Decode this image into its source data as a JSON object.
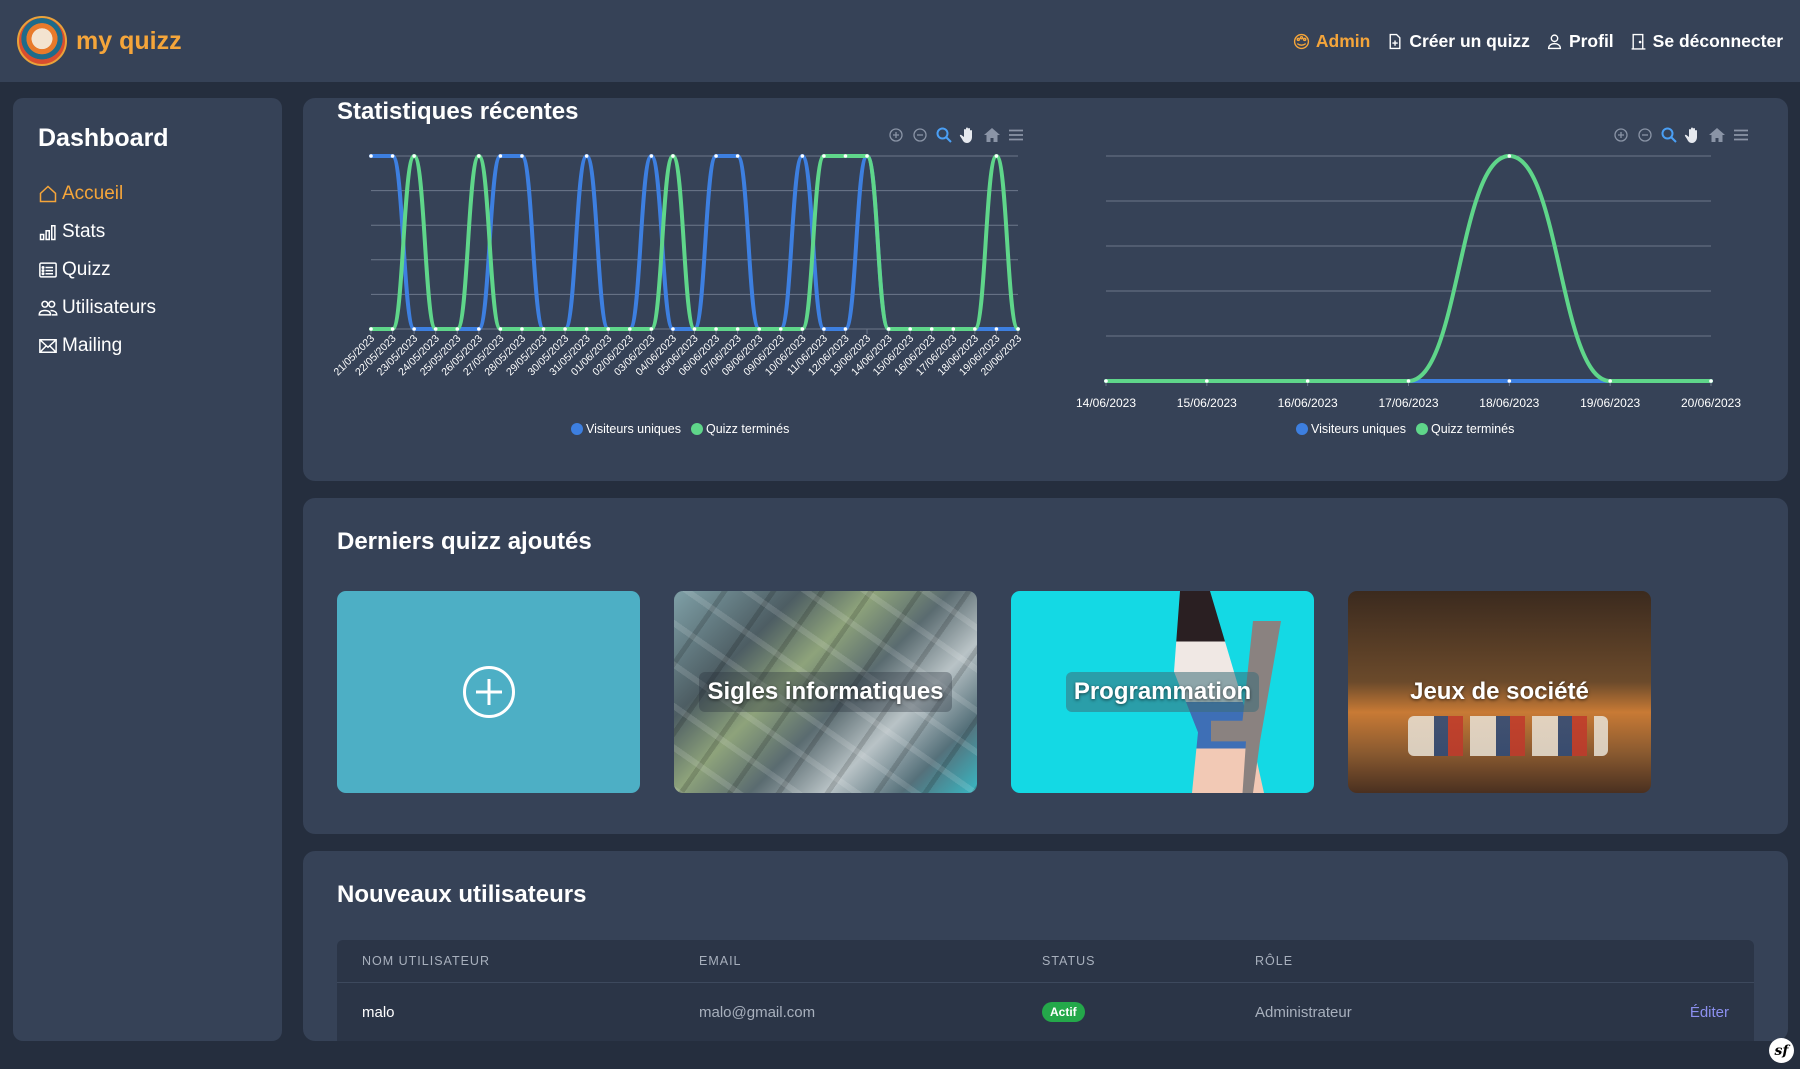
{
  "brand": {
    "name": "my quizz"
  },
  "topnav": {
    "items": [
      {
        "label": "Admin",
        "icon": "palette-icon",
        "active": true
      },
      {
        "label": "Créer un quizz",
        "icon": "file-plus-icon",
        "active": false
      },
      {
        "label": "Profil",
        "icon": "user-icon",
        "active": false
      },
      {
        "label": "Se déconnecter",
        "icon": "door-icon",
        "active": false
      }
    ]
  },
  "sidebar": {
    "title": "Dashboard",
    "items": [
      {
        "label": "Accueil",
        "icon": "home-icon",
        "active": true
      },
      {
        "label": "Stats",
        "icon": "bar-chart-icon",
        "active": false
      },
      {
        "label": "Quizz",
        "icon": "list-card-icon",
        "active": false
      },
      {
        "label": "Utilisateurs",
        "icon": "users-icon",
        "active": false
      },
      {
        "label": "Mailing",
        "icon": "envelope-icon",
        "active": false
      }
    ]
  },
  "stats": {
    "title": "Statistiques récentes",
    "legend": {
      "series_a": "Visiteurs uniques",
      "series_b": "Quizz terminés"
    },
    "colors": {
      "series_a": "#3d7fe0",
      "series_b": "#5fd68a",
      "grid": "#6c778a",
      "active_tool": "#4a9ff5",
      "tool": "#8a94a6"
    }
  },
  "chart_data": [
    {
      "type": "line",
      "x": [
        "21/05/2023",
        "22/05/2023",
        "23/05/2023",
        "24/05/2023",
        "25/05/2023",
        "26/05/2023",
        "27/05/2023",
        "28/05/2023",
        "29/05/2023",
        "30/05/2023",
        "31/05/2023",
        "01/06/2023",
        "02/06/2023",
        "03/06/2023",
        "04/06/2023",
        "05/06/2023",
        "06/06/2023",
        "07/06/2023",
        "08/06/2023",
        "09/06/2023",
        "10/06/2023",
        "11/06/2023",
        "12/06/2023",
        "13/06/2023",
        "14/06/2023",
        "15/06/2023",
        "16/06/2023",
        "17/06/2023",
        "18/06/2023",
        "19/06/2023",
        "20/06/2023"
      ],
      "series": [
        {
          "name": "Visiteurs uniques",
          "values": [
            1,
            1,
            0,
            0,
            0,
            0,
            1,
            1,
            0,
            0,
            1,
            0,
            0,
            1,
            0,
            0,
            1,
            1,
            0,
            0,
            1,
            0,
            0,
            1,
            0,
            0,
            0,
            0,
            0,
            0,
            0
          ]
        },
        {
          "name": "Quizz terminés",
          "values": [
            0,
            0,
            1,
            0,
            0,
            1,
            0,
            0,
            0,
            0,
            0,
            0,
            0,
            0,
            1,
            0,
            0,
            0,
            0,
            0,
            0,
            1,
            1,
            1,
            0,
            0,
            0,
            0,
            0,
            1,
            0
          ]
        }
      ],
      "ylim": [
        0,
        1
      ],
      "grid": true,
      "legend_position": "bottom"
    },
    {
      "type": "line",
      "x": [
        "14/06/2023",
        "15/06/2023",
        "16/06/2023",
        "17/06/2023",
        "18/06/2023",
        "19/06/2023",
        "20/06/2023"
      ],
      "series": [
        {
          "name": "Visiteurs uniques",
          "values": [
            0,
            0,
            0,
            0,
            0,
            0,
            0
          ]
        },
        {
          "name": "Quizz terminés",
          "values": [
            0,
            0,
            0,
            0,
            1,
            0,
            0
          ]
        }
      ],
      "ylim": [
        0,
        1
      ],
      "grid": true,
      "legend_position": "bottom"
    }
  ],
  "quizz": {
    "title": "Derniers quizz ajoutés",
    "cards": [
      {
        "label": "Sigles informatiques"
      },
      {
        "label": "Programmation"
      },
      {
        "label": "Jeux de société"
      }
    ]
  },
  "users": {
    "title": "Nouveaux utilisateurs",
    "columns": [
      "NOM UTILISATEUR",
      "EMAIL",
      "STATUS",
      "RÔLE"
    ],
    "rows": [
      {
        "username": "malo",
        "email": "malo@gmail.com",
        "status": "Actif",
        "role": "Administrateur",
        "action": "Éditer"
      }
    ]
  }
}
